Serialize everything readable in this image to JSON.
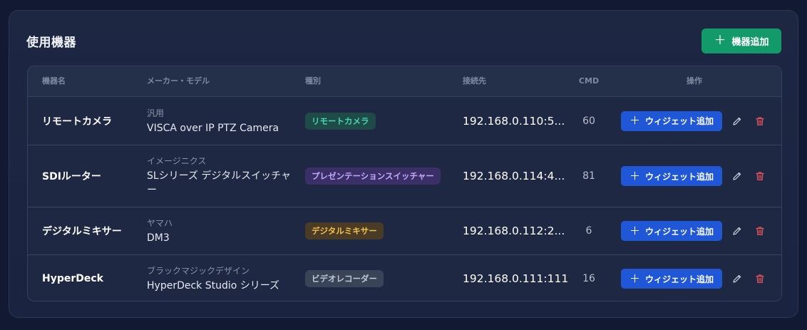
{
  "card": {
    "title": "使用機器",
    "add_device_label": "機器追加"
  },
  "table": {
    "headers": {
      "name": "機器名",
      "maker_model": "メーカー・モデル",
      "type": "種別",
      "connection": "接続先",
      "cmd": "CMD",
      "actions": "操作"
    },
    "rows": [
      {
        "name": "リモートカメラ",
        "maker": "汎用",
        "model": "VISCA over IP PTZ Camera",
        "type": "リモートカメラ",
        "connection": "192.168.0.110:5...",
        "cmd": "60",
        "widget_label": "ウィジェット追加"
      },
      {
        "name": "SDIルーター",
        "maker": "イメージニクス",
        "model": "SLシリーズ デジタルスイッチャー",
        "type": "プレゼンテーションスイッチャー",
        "connection": "192.168.0.114:4...",
        "cmd": "81",
        "widget_label": "ウィジェット追加"
      },
      {
        "name": "デジタルミキサー",
        "maker": "ヤマハ",
        "model": "DM3",
        "type": "デジタルミキサー",
        "connection": "192.168.0.112:2...",
        "cmd": "6",
        "widget_label": "ウィジェット追加"
      },
      {
        "name": "HyperDeck",
        "maker": "ブラックマジックデザイン",
        "model": "HyperDeck Studio シリーズ",
        "type": "ビデオレコーダー",
        "connection": "192.168.0.111:1111",
        "cmd": "16",
        "widget_label": "ウィジェット追加"
      }
    ]
  },
  "icons": {
    "plus": "plus-icon",
    "edit": "pencil-icon",
    "delete": "trash-icon"
  },
  "colors": {
    "primary_green": "#139a6a",
    "primary_blue": "#2057d6",
    "danger": "#e0555b"
  }
}
